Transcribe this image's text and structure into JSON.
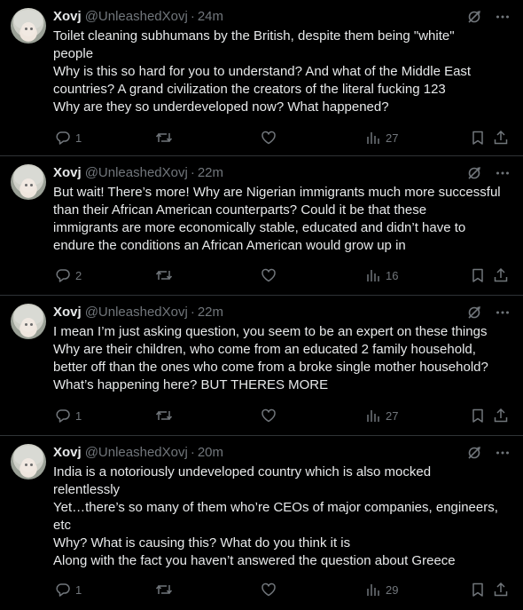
{
  "tweets": [
    {
      "name": "Xovj",
      "handle": "@UnleashedXovj",
      "time": "24m",
      "lines": [
        "Toilet cleaning subhumans by the British, despite them being \"white\"",
        "people",
        "Why is this so hard for you to understand? And what of the Middle East",
        "countries? A grand civilization the creators of the literal  fucking 123",
        "Why are they so underdeveloped now?  What happened?"
      ],
      "replies": "1",
      "views": "27"
    },
    {
      "name": "Xovj",
      "handle": "@UnleashedXovj",
      "time": "22m",
      "lines": [
        "But wait! There’s more! Why are Nigerian immigrants much more successful",
        "than their African American counterparts? Could it be that these",
        "immigrants are more economically stable, educated and didn’t have to",
        "endure the conditions an African American would grow up in"
      ],
      "replies": "2",
      "views": "16"
    },
    {
      "name": "Xovj",
      "handle": "@UnleashedXovj",
      "time": "22m",
      "lines": [
        "I mean I’m just asking question, you seem to be an expert on these things",
        "Why are their children, who come from an educated 2 family household,",
        "better off than the ones who come from a broke single mother household?",
        "What’s happening here? BUT THERES MORE"
      ],
      "replies": "1",
      "views": "27"
    },
    {
      "name": "Xovj",
      "handle": "@UnleashedXovj",
      "time": "20m",
      "lines": [
        "India is a notoriously undeveloped country which is also mocked",
        "relentlessly",
        "Yet…there’s so many of them who’re CEOs of major companies, engineers,",
        "etc",
        "Why? What is causing this? What do you think it is",
        "Along with the fact you haven’t answered the question about Greece"
      ],
      "replies": "1",
      "views": "29"
    }
  ],
  "icons": {
    "reply": "reply-icon",
    "retweet": "retweet-icon",
    "like": "like-icon",
    "views": "views-icon",
    "bookmark": "bookmark-icon",
    "share": "share-icon",
    "grok": "grok-icon",
    "more": "more-icon"
  },
  "colors": {
    "background": "#000000",
    "text": "#e7e9ea",
    "muted": "#71767b",
    "divider": "#2f3336"
  }
}
